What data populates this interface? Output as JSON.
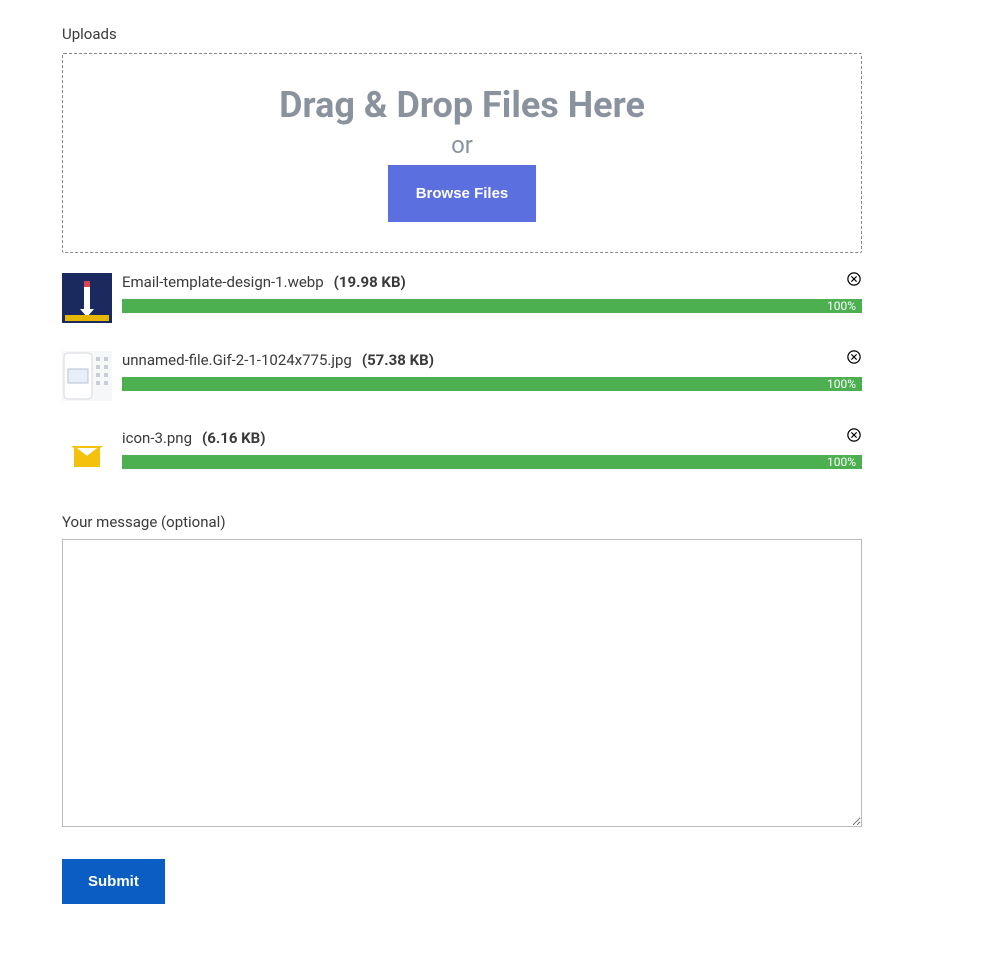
{
  "uploads_label": "Uploads",
  "dropzone": {
    "title": "Drag & Drop Files Here",
    "or": "or",
    "browse_label": "Browse Files"
  },
  "files": [
    {
      "name": "Email-template-design-1.webp",
      "size": "19.98 KB",
      "progress": "100%"
    },
    {
      "name": "unnamed-file.Gif-2-1-1024x775.jpg",
      "size": "57.38 KB",
      "progress": "100%"
    },
    {
      "name": "icon-3.png",
      "size": "6.16 KB",
      "progress": "100%"
    }
  ],
  "message_label": "Your message (optional)",
  "submit_label": "Submit"
}
